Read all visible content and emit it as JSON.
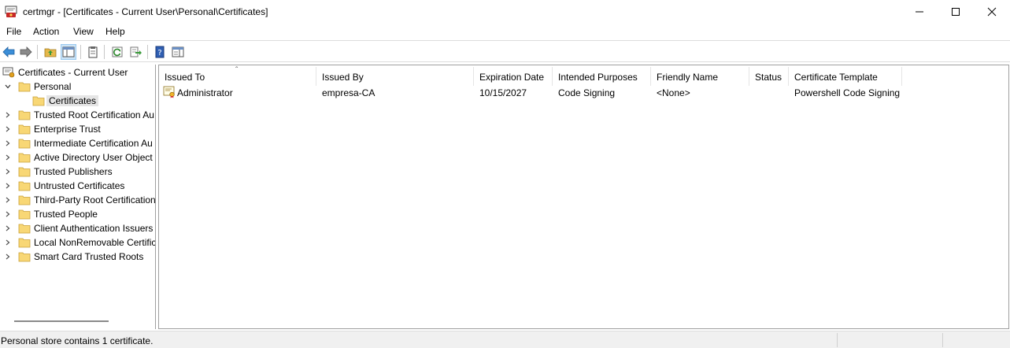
{
  "window": {
    "title": "certmgr - [Certificates - Current User\\Personal\\Certificates]"
  },
  "menu": {
    "file": "File",
    "action": "Action",
    "view": "View",
    "help": "Help"
  },
  "tree": {
    "root": "Certificates - Current User",
    "personal": "Personal",
    "certificates": "Certificates",
    "items": [
      "Trusted Root Certification Au",
      "Enterprise Trust",
      "Intermediate Certification Au",
      "Active Directory User Object",
      "Trusted Publishers",
      "Untrusted Certificates",
      "Third-Party Root Certification",
      "Trusted People",
      "Client Authentication Issuers",
      "Local NonRemovable Certific",
      "Smart Card Trusted Roots"
    ]
  },
  "list": {
    "columns": {
      "issued_to": "Issued To",
      "issued_by": "Issued By",
      "expiration": "Expiration Date",
      "purposes": "Intended Purposes",
      "friendly": "Friendly Name",
      "status": "Status",
      "template": "Certificate Template"
    },
    "rows": [
      {
        "issued_to": "Administrator",
        "issued_by": "empresa-CA",
        "expiration": "10/15/2027",
        "purposes": "Code Signing",
        "friendly": "<None>",
        "status": "",
        "template": "Powershell Code Signing"
      }
    ]
  },
  "status": {
    "text": "Personal store contains 1 certificate."
  },
  "colors": {
    "selected_bg": "#e5e5e5",
    "toolbar_active_bg": "#cce4f7",
    "folder_yellow": "#f8d775"
  }
}
